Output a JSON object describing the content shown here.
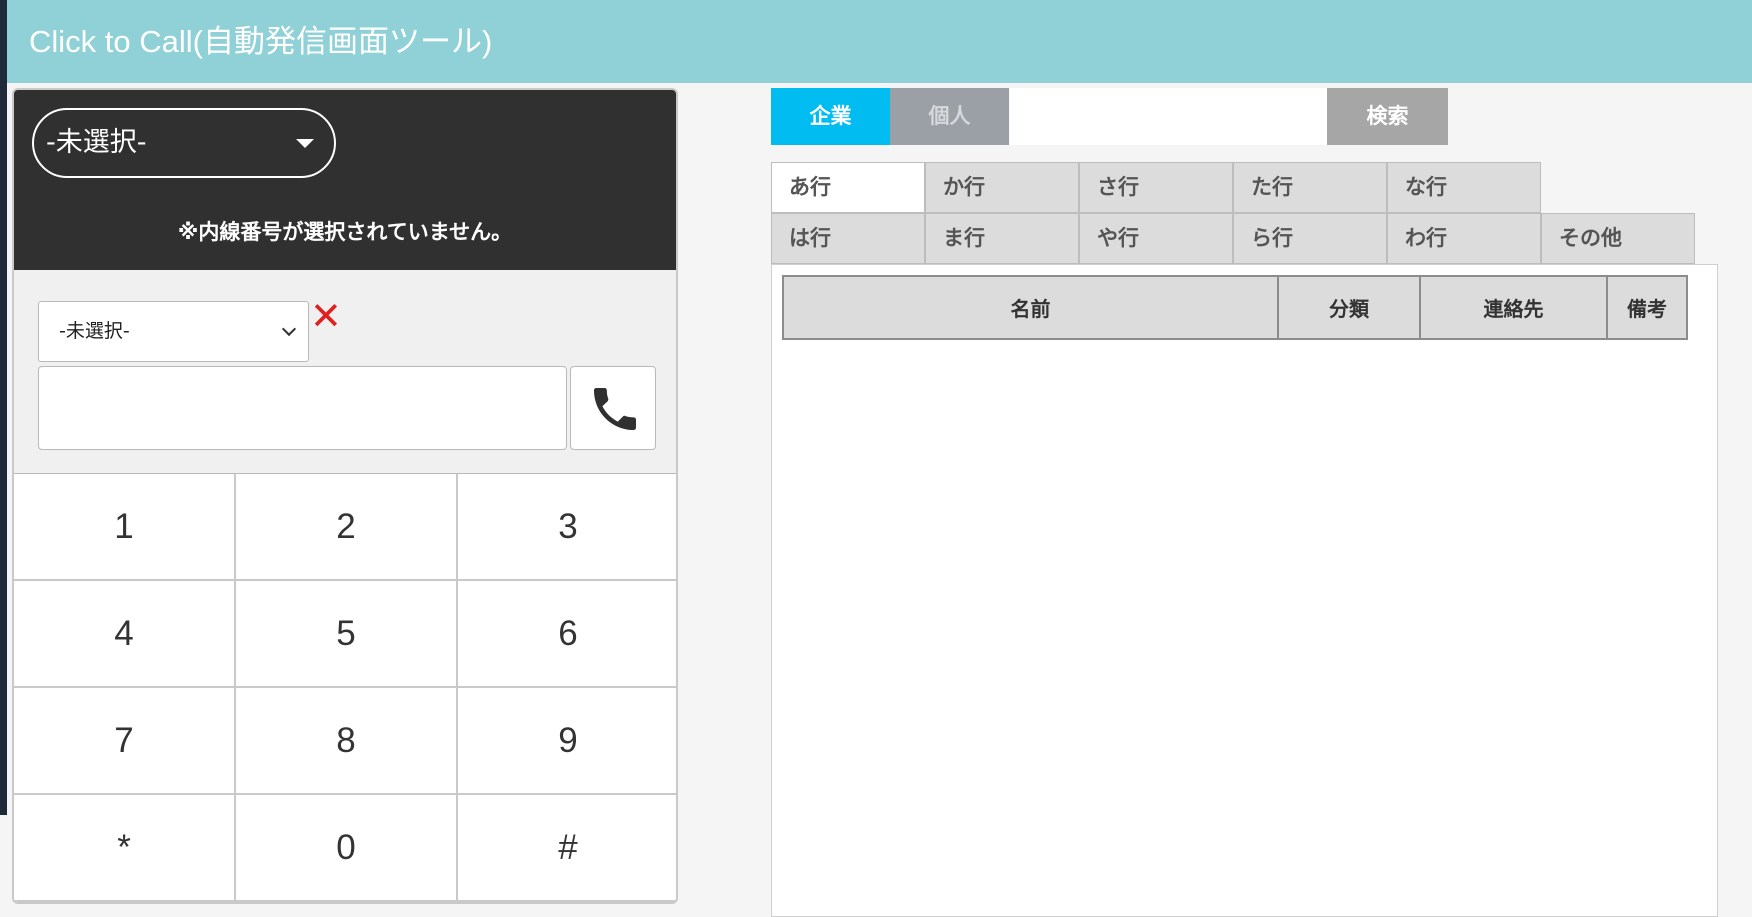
{
  "app": {
    "title": "Click to Call(自動発信画面ツール)"
  },
  "phone": {
    "extension_select": "-未選択-",
    "extension_warning": "※内線番号が選択されていません。",
    "line_select": "-未選択-",
    "clear_symbol": "✕",
    "number_value": "",
    "keys": [
      "1",
      "2",
      "3",
      "4",
      "5",
      "6",
      "7",
      "8",
      "9",
      "*",
      "0",
      "#"
    ]
  },
  "directory": {
    "tabs": {
      "company": "企業",
      "person": "個人"
    },
    "search_value": "",
    "search_button": "検索",
    "kana_tabs": [
      "あ行",
      "か行",
      "さ行",
      "た行",
      "な行",
      "は行",
      "ま行",
      "や行",
      "ら行",
      "わ行",
      "その他"
    ],
    "active_kana": "あ行",
    "table_headers": [
      "名前",
      "分類",
      "連絡先",
      "備考"
    ]
  },
  "icons": {
    "call": "phone-handset-icon",
    "clear": "x-icon",
    "dropdown": "caret-down-icon",
    "select": "chevron-down-icon"
  },
  "colors": {
    "header": "#90d1d8",
    "active_tab": "#00bcf0",
    "inactive_tab": "#9aa0a6",
    "clear_icon": "#e02020",
    "phone_panel": "#303030"
  }
}
